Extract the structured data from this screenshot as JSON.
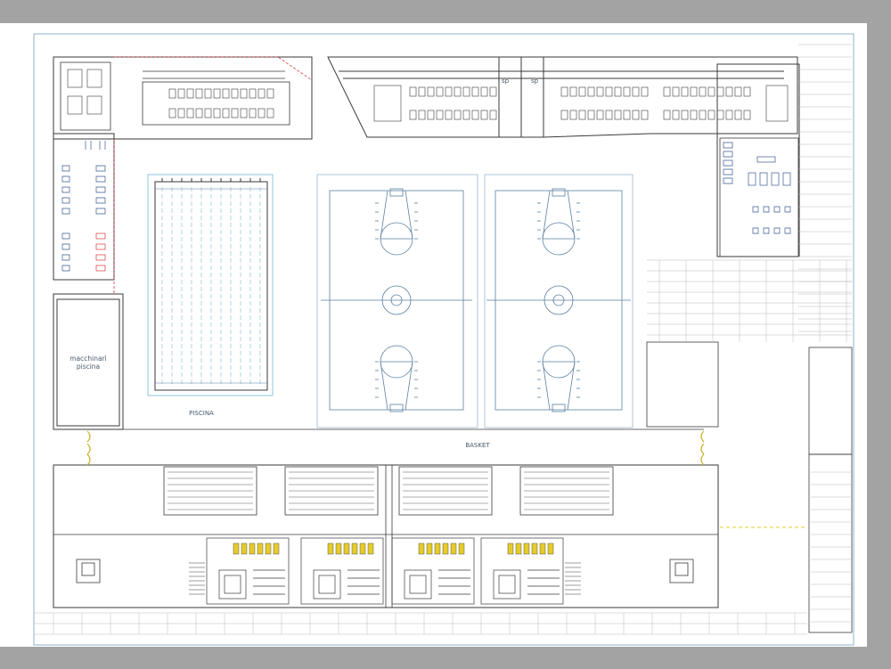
{
  "labels": {
    "pool": "PISCINA",
    "basket": "BASKET",
    "machinery_line1": "macchinari",
    "machinery_line2": "piscina",
    "sp_left": "sp",
    "sp_right": "sp"
  },
  "colors": {
    "background": "#a3a3a3",
    "paper": "#ffffff",
    "line_dark": "#3a3a3a",
    "line_blue": "#5a7fa0",
    "line_cyan": "#8ec4dc",
    "hatch_yellow": "#e6cc2a",
    "border_red": "#d43a3a"
  }
}
